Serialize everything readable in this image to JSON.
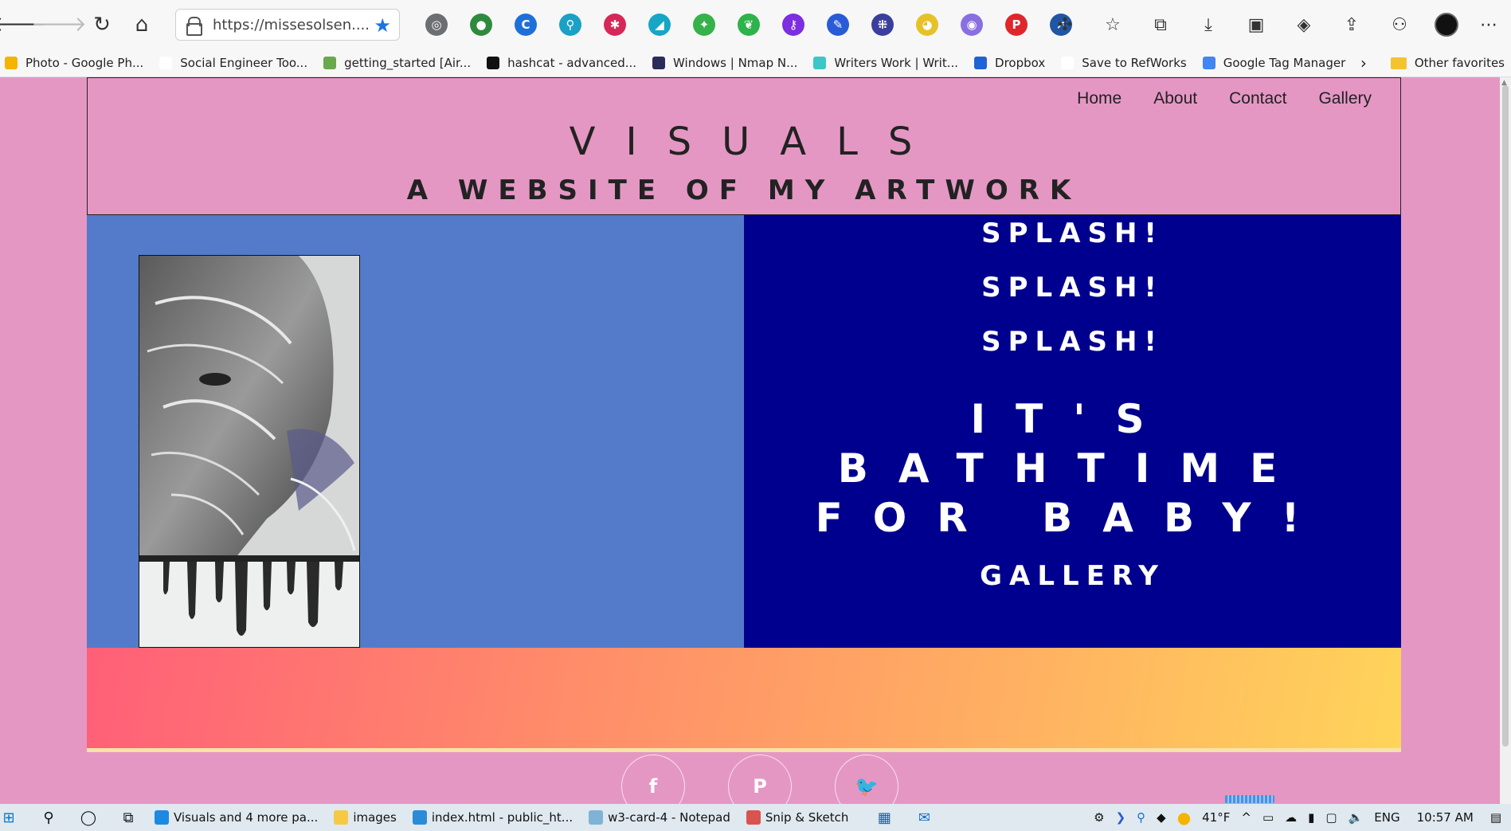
{
  "browser": {
    "url": "https://missesolsen....",
    "extensions": [
      {
        "name": "gray-extension-icon",
        "color": "#6b6f73",
        "glyph": "◎"
      },
      {
        "name": "green-shield-extension-icon",
        "color": "#2e8b3e",
        "glyph": "●"
      },
      {
        "name": "blue-c-extension-icon",
        "color": "#1e6fd9",
        "glyph": "C"
      },
      {
        "name": "search-extension-icon",
        "color": "#1ba1c4",
        "glyph": "⚲"
      },
      {
        "name": "red-bug-extension-icon",
        "color": "#d62858",
        "glyph": "✱"
      },
      {
        "name": "teal-extension-icon",
        "color": "#17a6c5",
        "glyph": "◢"
      },
      {
        "name": "colorful-extension-icon",
        "color": "#35b24a",
        "glyph": "✦"
      },
      {
        "name": "evernote-extension-icon",
        "color": "#2db34a",
        "glyph": "❦"
      },
      {
        "name": "purple-key-extension-icon",
        "color": "#7c2ee0",
        "glyph": "⚷"
      },
      {
        "name": "blue-pen-extension-icon",
        "color": "#2a5bd7",
        "glyph": "✎"
      },
      {
        "name": "grid-extension-icon",
        "color": "#3a3f9e",
        "glyph": "⁜"
      },
      {
        "name": "yellow-extension-icon",
        "color": "#e6c229",
        "glyph": "◕"
      },
      {
        "name": "violet-extension-icon",
        "color": "#8a6fe0",
        "glyph": "◉"
      },
      {
        "name": "pinterest-extension-icon",
        "color": "#e0262b",
        "glyph": "P"
      },
      {
        "name": "blue-arrow-extension-icon",
        "color": "#2156a5",
        "glyph": "➚"
      }
    ],
    "bookmarks": [
      {
        "label": "Photo - Google Ph...",
        "color": "#f4b400"
      },
      {
        "label": "Social Engineer Too...",
        "color": "#ffffff"
      },
      {
        "label": "getting_started [Air...",
        "color": "#6aa84f"
      },
      {
        "label": "hashcat - advanced...",
        "color": "#111111"
      },
      {
        "label": "Windows | Nmap N...",
        "color": "#2b2b5a"
      },
      {
        "label": "Writers Work | Writ...",
        "color": "#3cc7c7"
      },
      {
        "label": "Dropbox",
        "color": "#1f62d6"
      },
      {
        "label": "Save to RefWorks",
        "color": "#ffffff"
      },
      {
        "label": "Google Tag Manager",
        "color": "#4285f4"
      }
    ],
    "other_favorites": "Other favorites"
  },
  "site": {
    "nav": [
      "Home",
      "About",
      "Contact",
      "Gallery"
    ],
    "title": "VISUALS",
    "subtitle": "A WEBSITE OF MY ARTWORK",
    "splash_lines": [
      "SPLASH!",
      "SPLASH!",
      "SPLASH!"
    ],
    "headline": "IT'S BATHTIME FOR BABY!",
    "gallery_link": "GALLERY",
    "social": [
      {
        "name": "facebook-icon",
        "glyph": "f"
      },
      {
        "name": "pinterest-icon",
        "glyph": "P"
      },
      {
        "name": "twitter-icon",
        "glyph": "🐦"
      }
    ],
    "colors": {
      "page_bg": "#e597c4",
      "left_panel": "#537bca",
      "right_panel": "#00008e",
      "gradient_start": "#ff5f78",
      "gradient_end": "#ffd45a"
    }
  },
  "taskbar": {
    "apps": [
      {
        "label": "Visuals and 4 more pa...",
        "color": "#1b8ae0"
      },
      {
        "label": "images",
        "color": "#f6c944"
      },
      {
        "label": "index.html - public_ht...",
        "color": "#2a8bd8"
      },
      {
        "label": "w3-card-4 - Notepad",
        "color": "#7fb3d5"
      },
      {
        "label": "Snip & Sketch",
        "color": "#d9534f"
      }
    ],
    "weather": "41°F",
    "language": "ENG",
    "time": "10:57 AM"
  }
}
